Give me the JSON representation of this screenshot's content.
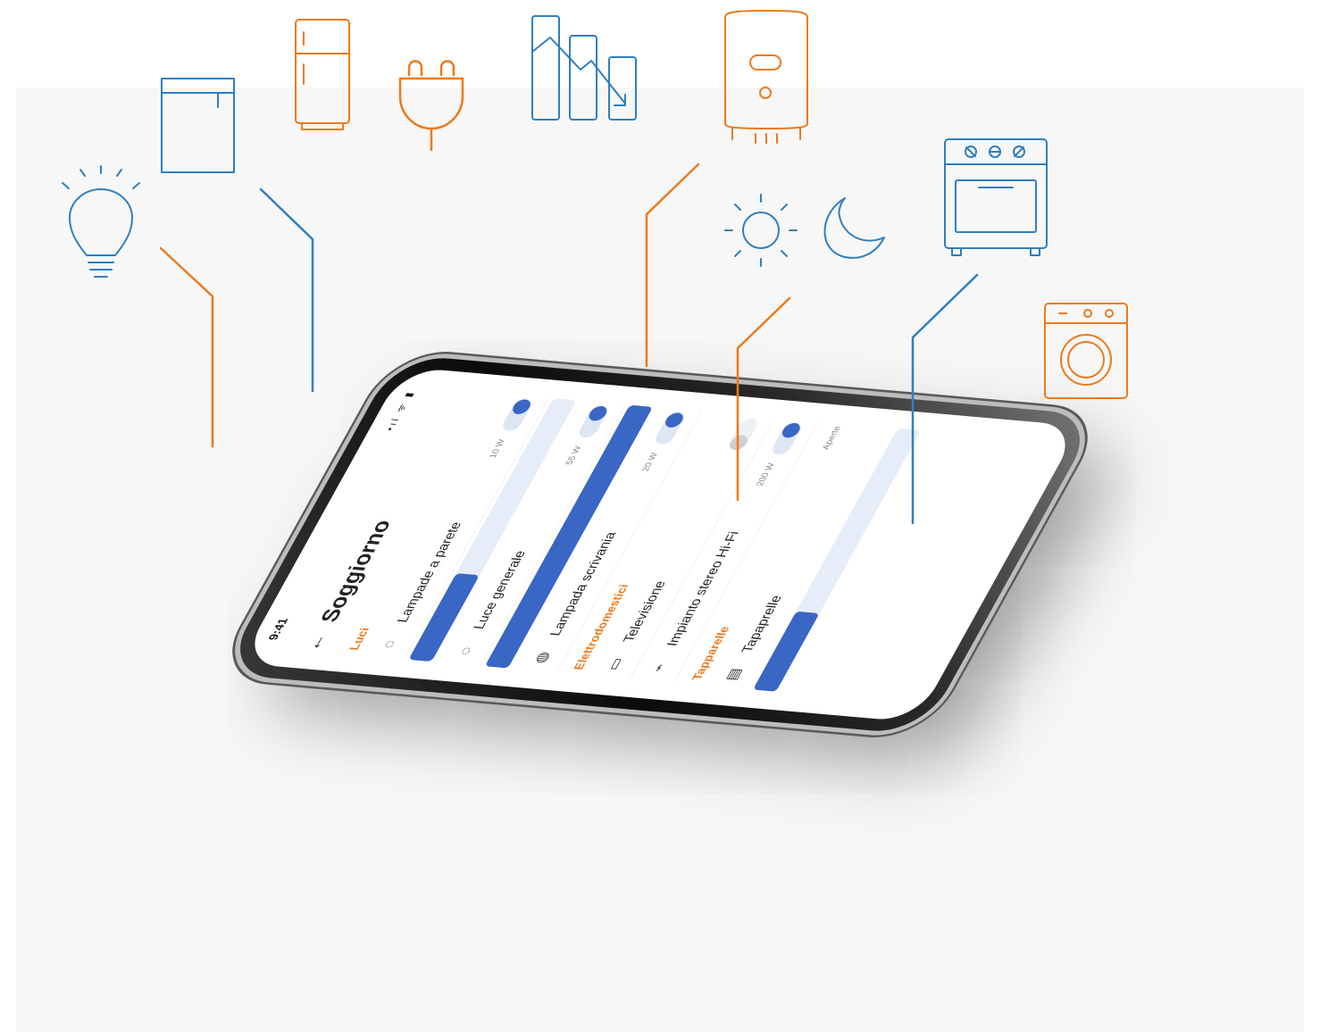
{
  "status": {
    "time": "9:41",
    "icons": "•ıl ᯤ ▮"
  },
  "header": {
    "back_icon": "←",
    "title": "Soggiorno"
  },
  "sections": {
    "lights": "Luci",
    "appliances": "Elettrodomestici",
    "blinds": "Tapparelle"
  },
  "lights": [
    {
      "name": "Lampade a parete",
      "watt": "10 W",
      "on": true,
      "level": 0.33,
      "icon": "bulb-icon"
    },
    {
      "name": "Luce generale",
      "watt": "55 W",
      "on": true,
      "level": 1.0,
      "icon": "bulb-icon"
    },
    {
      "name": "Lampada scrivania",
      "watt": "20 W",
      "on": true,
      "icon": "desk-lamp-icon"
    }
  ],
  "appliances": [
    {
      "name": "Televisione",
      "on": false,
      "icon": "tv-icon"
    },
    {
      "name": "Impianto stereo Hi-Fi",
      "watt": "200 W",
      "on": true,
      "icon": "plug-icon"
    }
  ],
  "blinds": [
    {
      "name": "Tapaprelle",
      "state": "Aperte",
      "level": 0.3,
      "icon": "blinds-icon"
    }
  ],
  "glyphs": {
    "bulb": "◌",
    "desk_lamp": "◍",
    "tv": "▭",
    "plug": "⌁",
    "blinds": "▤"
  },
  "colors": {
    "accent_blue": "#3a66c4",
    "accent_orange": "#ec7a1c",
    "icon_blue": "#2f7fc1"
  },
  "floating_icons": [
    "lightbulb-icon",
    "dishwasher-icon",
    "fridge-icon",
    "plug-icon",
    "energy-chart-icon",
    "water-heater-icon",
    "sun-icon",
    "moon-icon",
    "oven-icon",
    "washing-machine-icon"
  ]
}
